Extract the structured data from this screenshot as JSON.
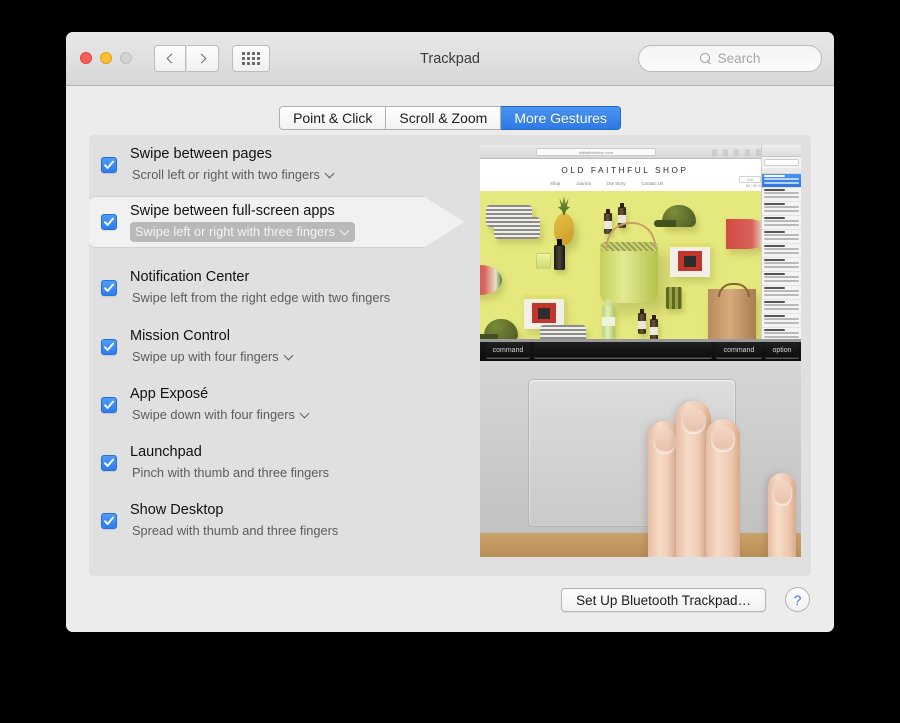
{
  "window": {
    "title": "Trackpad",
    "traffic_lights": [
      "close",
      "minimize",
      "zoom"
    ],
    "toolbar": {
      "back_icon": "chevron-left-icon",
      "forward_icon": "chevron-right-icon",
      "show_all_icon": "grid-dots-icon"
    },
    "search": {
      "placeholder": "Search",
      "icon": "search-icon",
      "value": ""
    }
  },
  "tabs": [
    {
      "label": "Point & Click",
      "active": false
    },
    {
      "label": "Scroll & Zoom",
      "active": false
    },
    {
      "label": "More Gestures",
      "active": true
    }
  ],
  "gestures": [
    {
      "title": "Swipe between pages",
      "subtitle": "Scroll left or right with two fingers",
      "checked": true,
      "has_popup": true,
      "selected": false
    },
    {
      "title": "Swipe between full-screen apps",
      "subtitle": "Swipe left or right with three fingers",
      "checked": true,
      "has_popup": true,
      "selected": true
    },
    {
      "title": "Notification Center",
      "subtitle": "Swipe left from the right edge with two fingers",
      "checked": true,
      "has_popup": false,
      "selected": false
    },
    {
      "title": "Mission Control",
      "subtitle": "Swipe up with four fingers",
      "checked": true,
      "has_popup": true,
      "selected": false
    },
    {
      "title": "App Exposé",
      "subtitle": "Swipe down with four fingers",
      "checked": true,
      "has_popup": true,
      "selected": false
    },
    {
      "title": "Launchpad",
      "subtitle": "Pinch with thumb and three fingers",
      "checked": true,
      "has_popup": false,
      "selected": false
    },
    {
      "title": "Show Desktop",
      "subtitle": "Spread with thumb and three fingers",
      "checked": true,
      "has_popup": false,
      "selected": false
    }
  ],
  "preview": {
    "browser": {
      "url": "oldfaithfulshop.com",
      "shop_title": "OLD FAITHFUL SHOP",
      "nav": [
        "Shop",
        "Journal",
        "Our Story",
        "Contact Us"
      ],
      "cart_label": "Cart",
      "price_label": "$0 / $0.00"
    },
    "keyboard_keys": [
      "command",
      "command",
      "option"
    ]
  },
  "footer": {
    "setup_button": "Set Up Bluetooth Trackpad…",
    "help_button": "?",
    "help_icon": "question-mark-icon"
  },
  "colors": {
    "accent_blue": "#2f7cef",
    "tab_active": "#3d8ef0",
    "panel_bg": "#e0e0e0",
    "window_bg": "#ececec"
  }
}
